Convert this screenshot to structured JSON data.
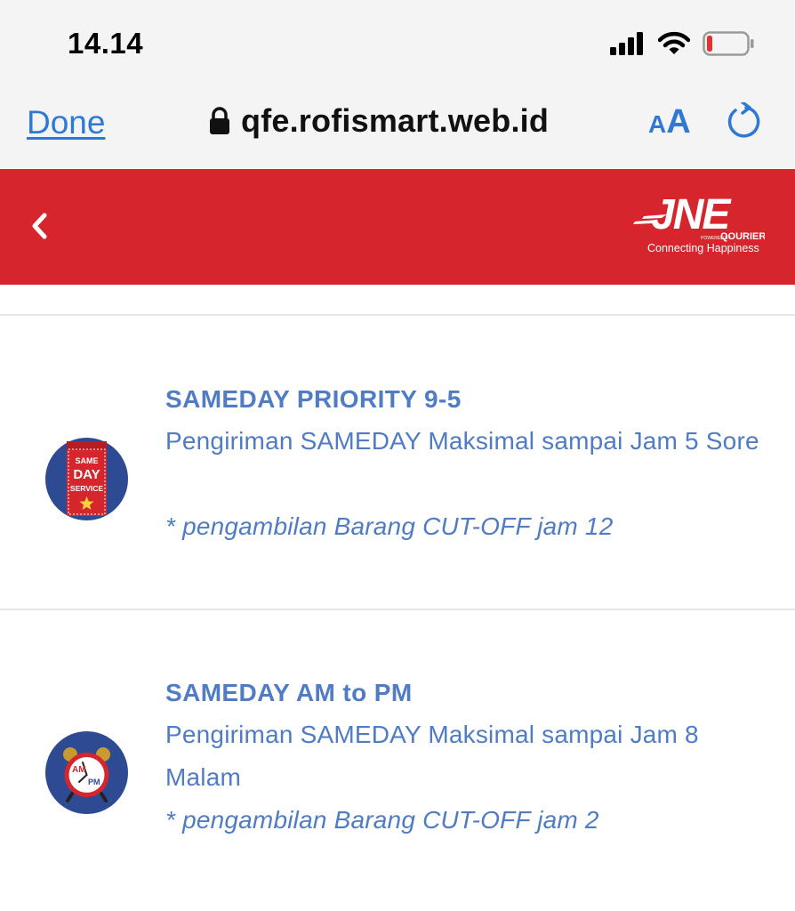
{
  "status_bar": {
    "time": "14.14",
    "icons": [
      "signal-icon",
      "wifi-icon",
      "battery-low-icon"
    ]
  },
  "browser": {
    "done_label": "Done",
    "url": "qfe.rofismart.web.id",
    "text_size_small": "A",
    "text_size_big": "A",
    "accent_color": "#2f79d6"
  },
  "header": {
    "background_color": "#d7252d",
    "logo": {
      "brand": "JNE",
      "powered_by": "POWERED BY",
      "sub_brand": "QOURIER",
      "tagline": "Connecting Happiness"
    }
  },
  "services": [
    {
      "title": "SAMEDAY PRIORITY 9-5",
      "description": "Pengiriman SAMEDAY Maksimal sampai Jam 5 Sore",
      "note": "* pengambilan Barang CUT-OFF jam 12",
      "icon": "sameday-service-badge-icon",
      "icon_text": [
        "SAME",
        "DAY",
        "SERVICE"
      ]
    },
    {
      "title": "SAMEDAY AM to PM",
      "description": "Pengiriman SAMEDAY Maksimal sampai Jam 8 Malam",
      "note": "* pengambilan Barang CUT-OFF jam 2",
      "icon": "alarm-clock-icon",
      "icon_text": [
        "AM",
        "PM"
      ]
    }
  ],
  "text_color": "#4f7cc4"
}
